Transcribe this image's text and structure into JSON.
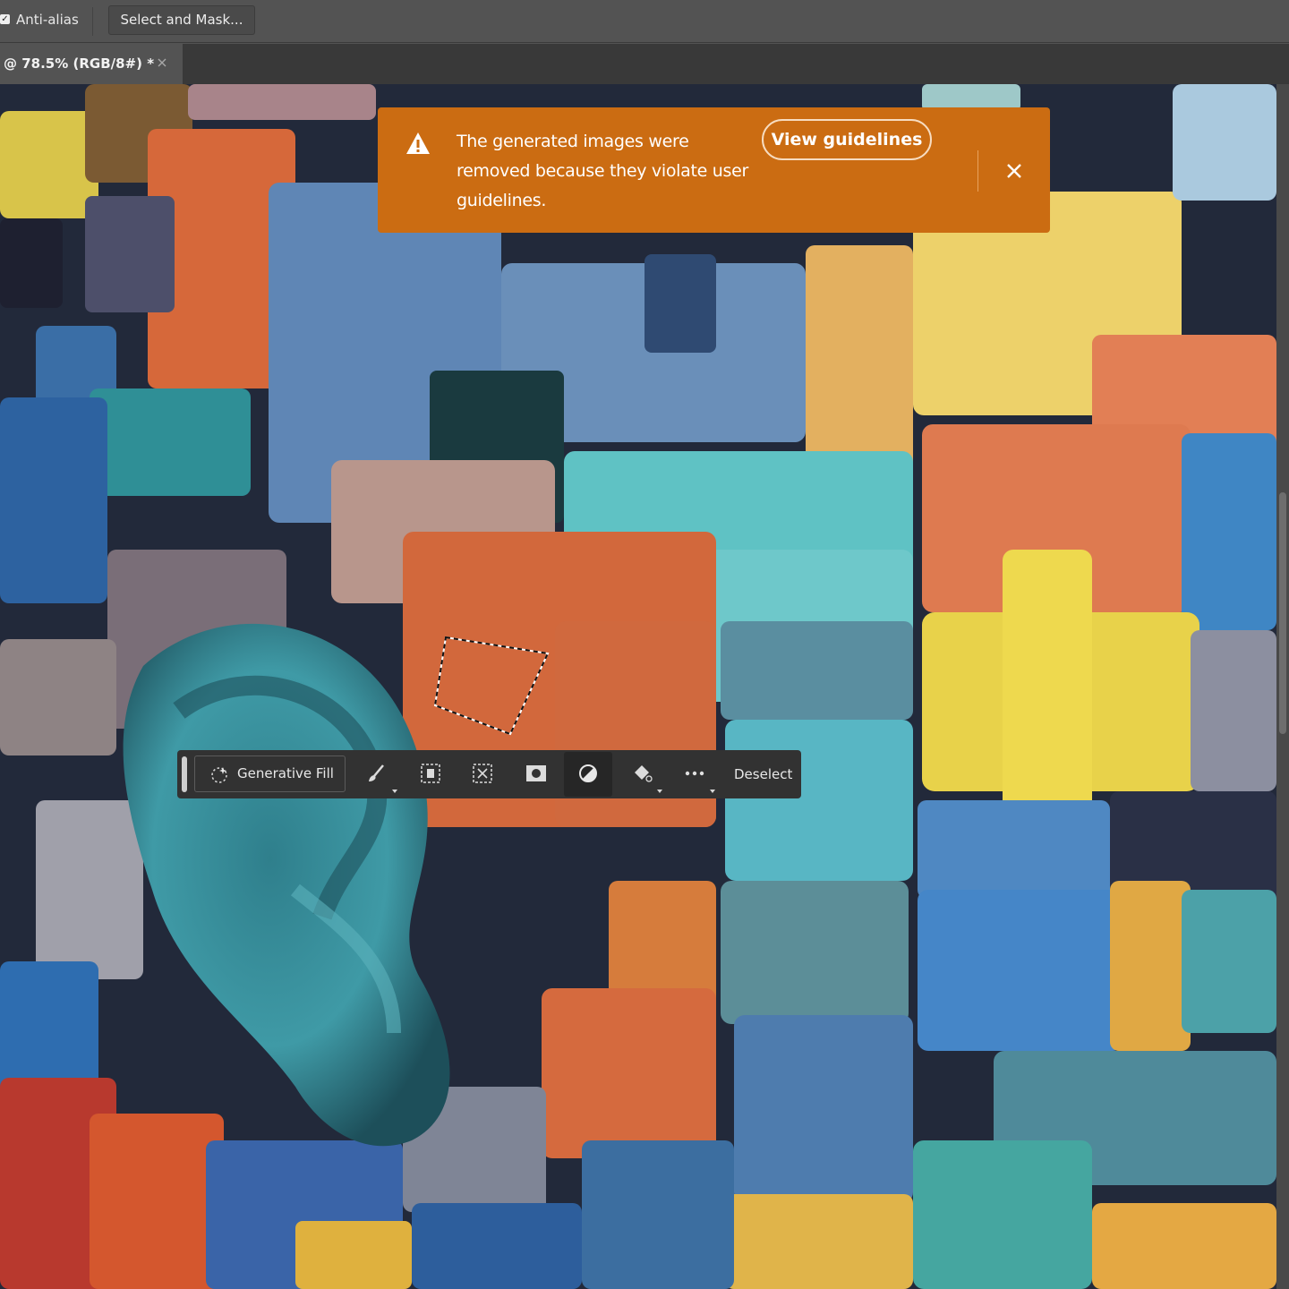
{
  "options_bar": {
    "anti_alias_checked": true,
    "anti_alias_label": "Anti-alias",
    "select_and_mask_label": "Select and Mask..."
  },
  "document_tab": {
    "title": "@ 78.5% (RGB/8#) *"
  },
  "toast": {
    "message": "The generated images were removed because they violate user guidelines.",
    "action_label": "View guidelines",
    "background_color": "#cb6c12",
    "icons": [
      "warning-icon",
      "close-icon"
    ]
  },
  "contextual_task_bar": {
    "generative_fill_label": "Generative Fill",
    "deselect_label": "Deselect",
    "icons": [
      "generative-fill-icon",
      "modify-selection-icon",
      "select-subject-icon",
      "transform-selection-icon",
      "create-mask-icon",
      "invert-selection-icon",
      "fill-selection-icon",
      "more-options-icon"
    ]
  }
}
